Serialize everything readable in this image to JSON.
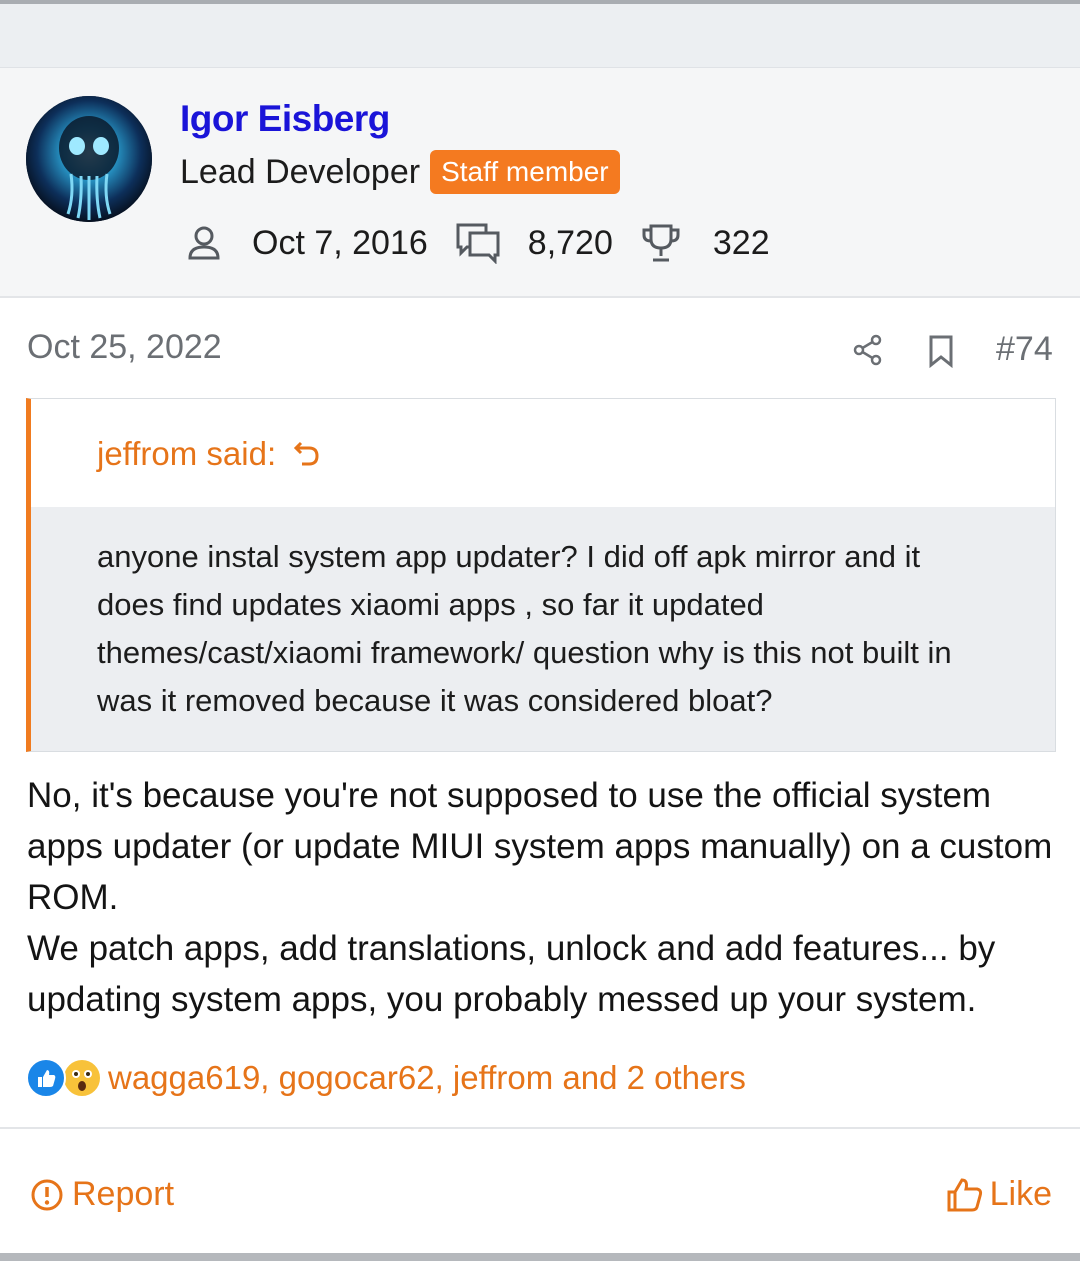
{
  "user": {
    "name": "Igor Eisberg",
    "title": "Lead Developer",
    "badge": "Staff member",
    "joined": "Oct 7, 2016",
    "messages": "8,720",
    "points": "322"
  },
  "post": {
    "date": "Oct 25, 2022",
    "number": "#74"
  },
  "quote": {
    "author": "jeffrom said:",
    "text": "anyone instal system app updater? I did off apk mirror and it does find updates xiaomi apps , so far it updated themes/cast/xiaomi framework/ question why is this not built in was it removed because it was considered bloat?"
  },
  "reply": {
    "paragraph1": "No, it's because you're not supposed to use the official system apps updater (or update MIUI system apps manually) on a custom ROM.",
    "paragraph2": "We patch apps, add translations, unlock and add features... by updating system apps, you probably messed up your system."
  },
  "reactions": {
    "icons": [
      "like-icon",
      "wow-icon"
    ],
    "users_text": "wagga619, gogocar62, jeffrom and 2 others"
  },
  "actions": {
    "report": "Report",
    "like": "Like"
  },
  "colors": {
    "accent": "#e67419",
    "badge": "#f47a20",
    "username": "#1a14d8",
    "quote_border": "#f07b1f"
  }
}
